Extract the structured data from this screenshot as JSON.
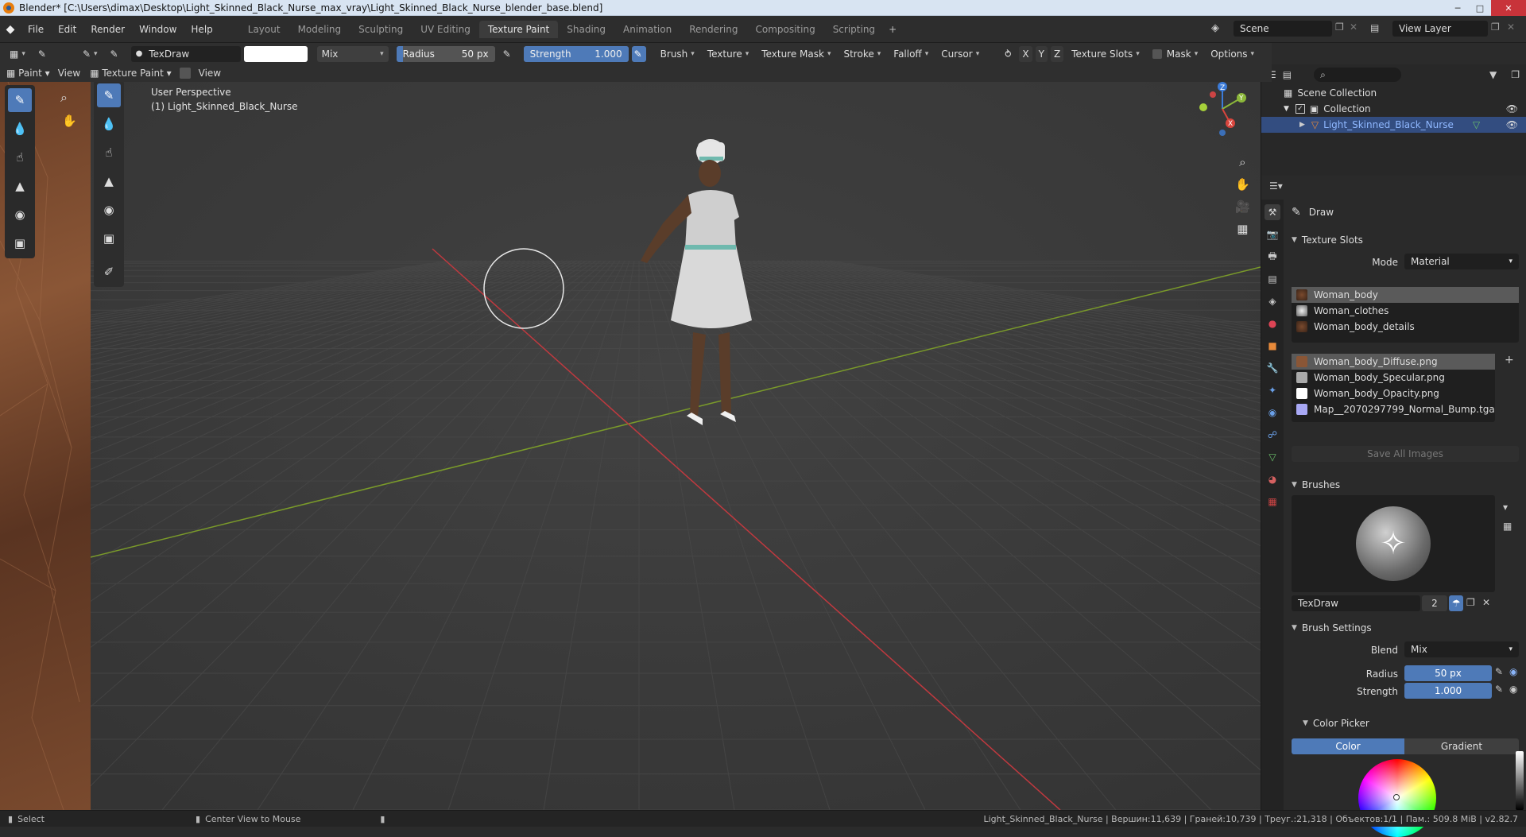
{
  "titlebar": {
    "title": "Blender* [C:\\Users\\dimax\\Desktop\\Light_Skinned_Black_Nurse_max_vray\\Light_Skinned_Black_Nurse_blender_base.blend]"
  },
  "menu": [
    "File",
    "Edit",
    "Render",
    "Window",
    "Help"
  ],
  "workspaces": [
    "Layout",
    "Modeling",
    "Sculpting",
    "UV Editing",
    "Texture Paint",
    "Shading",
    "Animation",
    "Rendering",
    "Compositing",
    "Scripting"
  ],
  "active_workspace": "Texture Paint",
  "scene": {
    "name": "Scene",
    "view_layer": "View Layer"
  },
  "toolhdr": {
    "brush_name": "TexDraw",
    "blend": "Mix",
    "radius_label": "Radius",
    "radius_value": "50 px",
    "strength_label": "Strength",
    "strength_value": "1.000",
    "menus": [
      "Brush",
      "Texture",
      "Texture Mask",
      "Stroke",
      "Falloff",
      "Cursor"
    ],
    "axes": [
      "X",
      "Y",
      "Z"
    ],
    "texture_slots": "Texture Slots",
    "mask": "Mask",
    "options": "Options"
  },
  "modehdr": {
    "left_mode": "Paint",
    "left_view": "View",
    "mode": "Texture Paint",
    "view": "View"
  },
  "viewport": {
    "perspective": "User Perspective",
    "object": "(1) Light_Skinned_Black_Nurse"
  },
  "gizmo": {
    "x": "X",
    "y": "Y",
    "z": "Z"
  },
  "outliner": {
    "scene_collection": "Scene Collection",
    "collection": "Collection",
    "object": "Light_Skinned_Black_Nurse"
  },
  "props": {
    "tool": "Draw",
    "texture_slots": {
      "header": "Texture Slots",
      "mode_label": "Mode",
      "mode_value": "Material",
      "materials": [
        "Woman_body",
        "Woman_clothes",
        "Woman_body_details"
      ],
      "images": [
        "Woman_body_Diffuse.png",
        "Woman_body_Specular.png",
        "Woman_body_Opacity.png",
        "Map__2070297799_Normal_Bump.tga"
      ],
      "save_all": "Save All Images"
    },
    "brushes": {
      "header": "Brushes",
      "name": "TexDraw",
      "users": "2"
    },
    "brush_settings": {
      "header": "Brush Settings",
      "blend_label": "Blend",
      "blend_value": "Mix",
      "radius_label": "Radius",
      "radius_value": "50 px",
      "strength_label": "Strength",
      "strength_value": "1.000",
      "color_picker": "Color Picker",
      "color_tab": "Color",
      "gradient_tab": "Gradient"
    }
  },
  "statusbar": {
    "select": "Select",
    "center_view": "Center View to Mouse",
    "stats": "Light_Skinned_Black_Nurse | Вершин:11,639 | Граней:10,739 | Треуг.:21,318 | Объектов:1/1 | Пам.: 509.8 MiB | v2.82.7"
  },
  "colors": {
    "accent": "#4e7ab8",
    "x_axis": "#c0393f",
    "y_axis": "#7a9a2a"
  }
}
